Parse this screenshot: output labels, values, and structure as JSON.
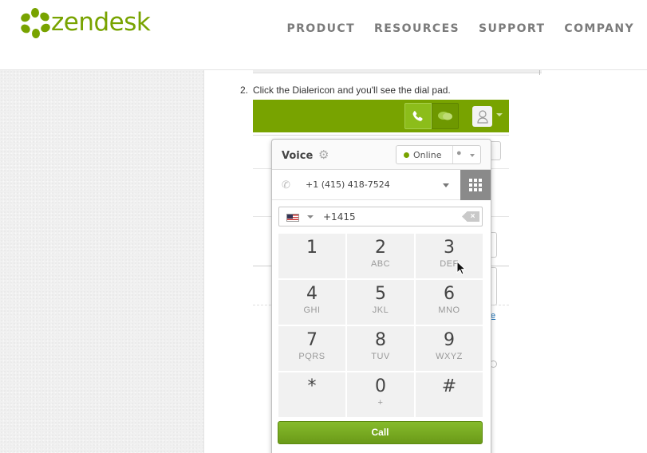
{
  "header": {
    "logo_text": "zendesk",
    "nav": [
      "PRODUCT",
      "RESOURCES",
      "SUPPORT",
      "COMPANY"
    ],
    "brand_color": "#78a300"
  },
  "article": {
    "step_number": "2.",
    "step_text": "Click the Dialericon and you'll see the dial pad.",
    "background_link": "e"
  },
  "dialer": {
    "title": "Voice",
    "status": "Online",
    "phone_line": "+1 (415) 418-7524",
    "input_value": "+1415",
    "keys": [
      {
        "digit": "1",
        "letters": ""
      },
      {
        "digit": "2",
        "letters": "ABC"
      },
      {
        "digit": "3",
        "letters": "DEF"
      },
      {
        "digit": "4",
        "letters": "GHI"
      },
      {
        "digit": "5",
        "letters": "JKL"
      },
      {
        "digit": "6",
        "letters": "MNO"
      },
      {
        "digit": "7",
        "letters": "PQRS"
      },
      {
        "digit": "8",
        "letters": "TUV"
      },
      {
        "digit": "9",
        "letters": "WXYZ"
      },
      {
        "digit": "*",
        "letters": ""
      },
      {
        "digit": "0",
        "letters": "+"
      },
      {
        "digit": "#",
        "letters": ""
      }
    ],
    "call_label": "Call"
  },
  "icons": [
    "zendesk-logo-icon",
    "phone-icon",
    "chat-icon",
    "avatar-icon",
    "gear-icon",
    "globe-icon",
    "phone-line-icon",
    "keypad-grid-icon",
    "us-flag-icon",
    "backspace-icon",
    "mouse-cursor-icon"
  ]
}
